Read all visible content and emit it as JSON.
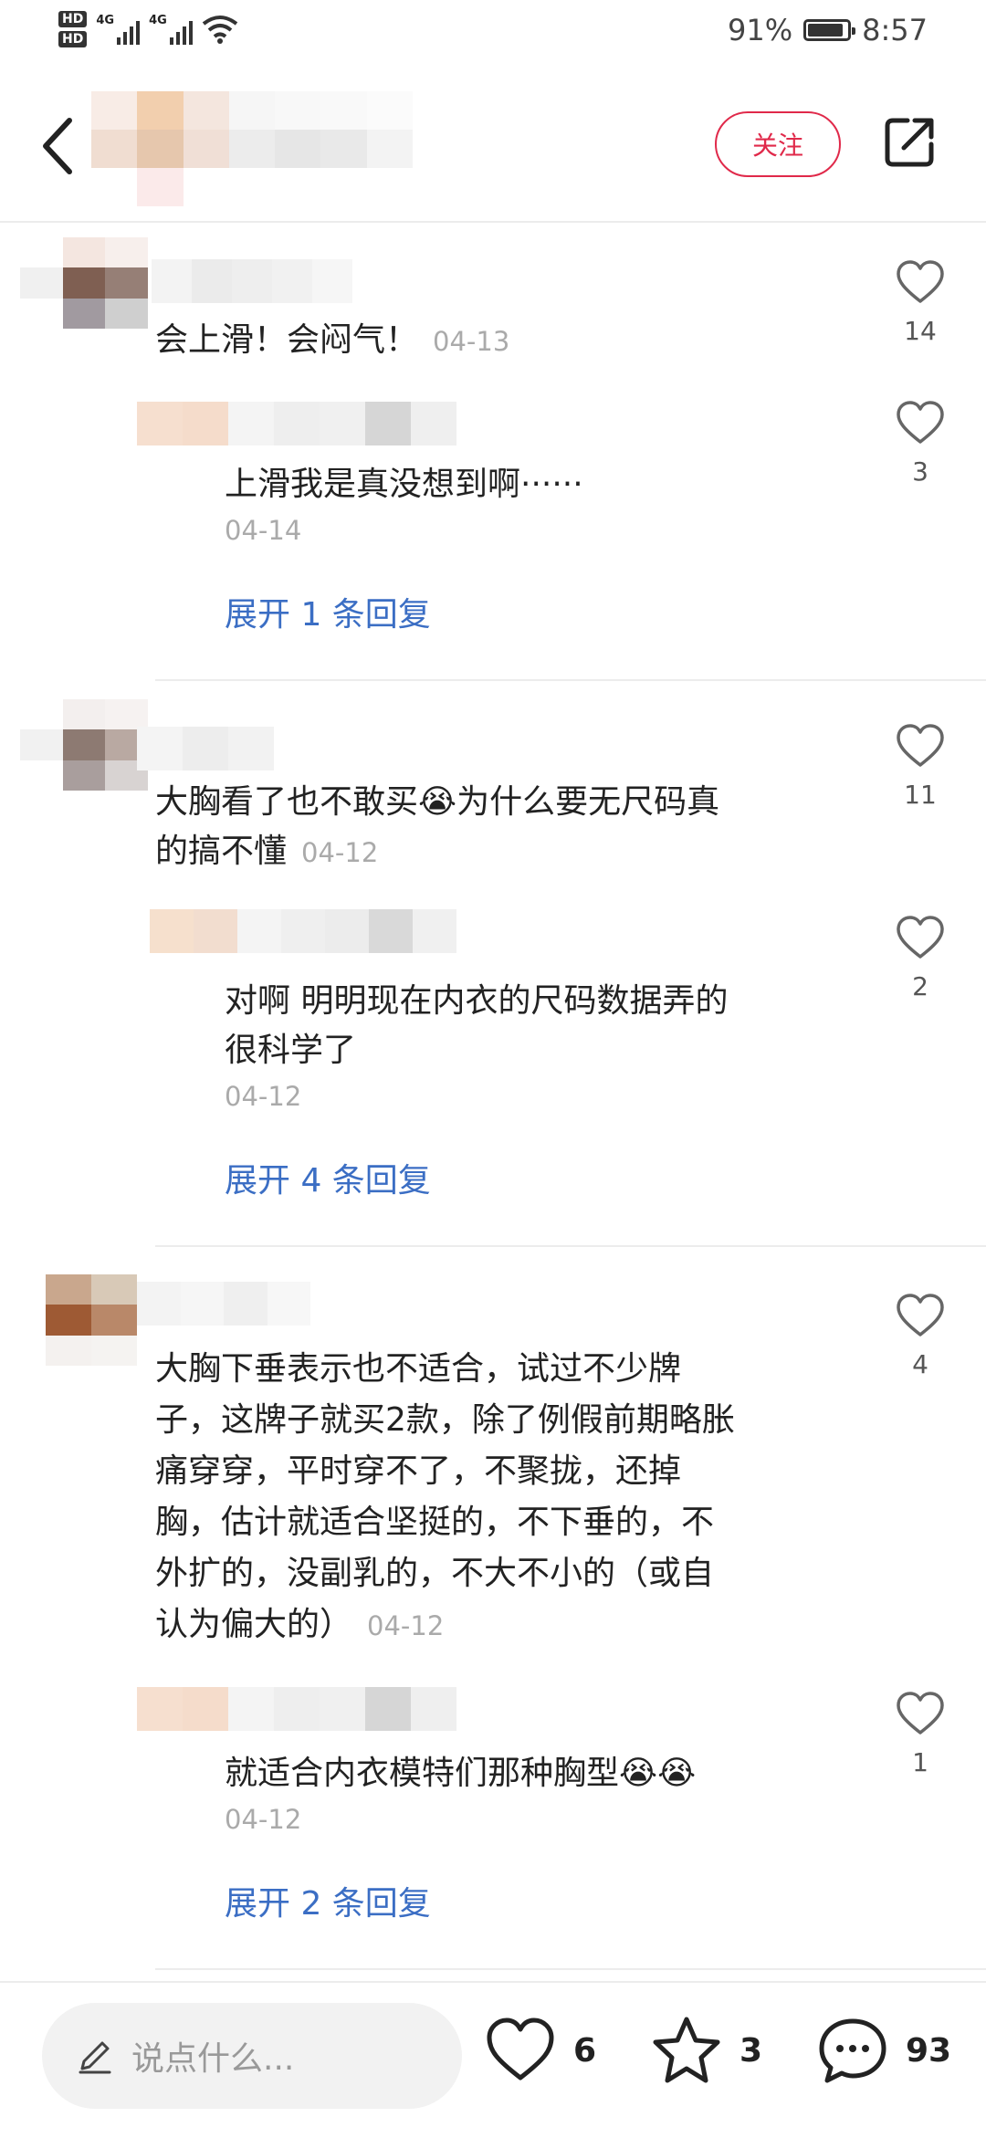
{
  "status_bar": {
    "sim1": "HD",
    "sim2": "HD",
    "net1": "4G",
    "net2": "4G",
    "battery": "91%",
    "battery_level": 0.91,
    "time": "8:57"
  },
  "header": {
    "follow_label": "关注"
  },
  "comments": [
    {
      "text": "会上滑！会闷气！",
      "date": "04-13",
      "likes": "14",
      "reply": {
        "text": "上滑我是真没想到啊······",
        "date": "04-14",
        "likes": "3"
      },
      "expand_label": "展开 1 条回复"
    },
    {
      "text_line1": "大胸看了也不敢买😭为什么要无尺码真",
      "text_line2": "的搞不懂",
      "date": "04-12",
      "likes": "11",
      "reply": {
        "text_line1": "对啊 明明现在内衣的尺码数据弄的",
        "text_line2": "很科学了",
        "date": "04-12",
        "likes": "2"
      },
      "expand_label": "展开 4 条回复"
    },
    {
      "text_lines": [
        "大胸下垂表示也不适合，试过不少牌",
        "子，这牌子就买2款，除了例假前期略胀",
        "痛穿穿，平时穿不了，不聚拢，还掉",
        "胸，估计就适合坚挺的，不下垂的，不",
        "外扩的，没副乳的，不大不小的（或自",
        "认为偏大的）"
      ],
      "date": "04-12",
      "likes": "4",
      "reply": {
        "text": "就适合内衣模特们那种胸型😭😭",
        "date": "04-12",
        "likes": "1"
      },
      "expand_label": "展开 2 条回复"
    }
  ],
  "bottom_bar": {
    "input_placeholder": "说点什么...",
    "likes": "6",
    "collects": "3",
    "comments": "93"
  },
  "icons": {
    "back": "chevron-left-icon",
    "share": "share-icon",
    "like": "heart-icon",
    "edit": "pencil-icon",
    "collect": "star-icon",
    "comment": "comment-bubble-icon"
  },
  "colors": {
    "accent": "#e0294a",
    "link": "#3b6ec4"
  }
}
